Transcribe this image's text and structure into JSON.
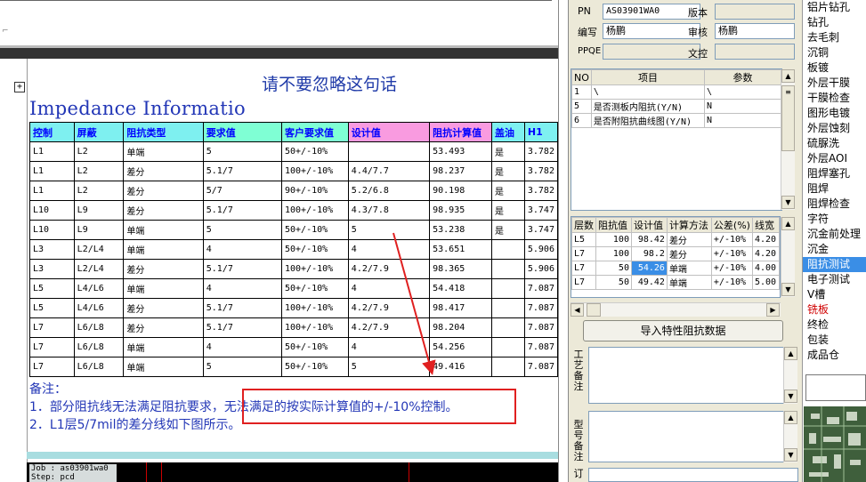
{
  "doc": {
    "banner": "请不要忽略这句话",
    "title": "Impedance Informatio",
    "plus_glyph": "+",
    "columns": [
      "控制",
      "屏蔽",
      "阻抗类型",
      "要求值",
      "客户要求值",
      "设计值",
      "阻抗计算值",
      "盖油",
      "H1"
    ],
    "rows": [
      [
        "L1",
        "L2",
        "单端",
        "5",
        "50+/-10%",
        "",
        "53.493",
        "是",
        "3.782"
      ],
      [
        "L1",
        "L2",
        "差分",
        "5.1/7",
        "100+/-10%",
        "4.4/7.7",
        "98.237",
        "是",
        "3.782"
      ],
      [
        "L1",
        "L2",
        "差分",
        "5/7",
        "90+/-10%",
        "5.2/6.8",
        "90.198",
        "是",
        "3.782"
      ],
      [
        "L10",
        "L9",
        "差分",
        "5.1/7",
        "100+/-10%",
        "4.3/7.8",
        "98.935",
        "是",
        "3.747"
      ],
      [
        "L10",
        "L9",
        "单端",
        "5",
        "50+/-10%",
        "5",
        "53.238",
        "是",
        "3.747"
      ],
      [
        "L3",
        "L2/L4",
        "单端",
        "4",
        "50+/-10%",
        "4",
        "53.651",
        "",
        "5.906"
      ],
      [
        "L3",
        "L2/L4",
        "差分",
        "5.1/7",
        "100+/-10%",
        "4.2/7.9",
        "98.365",
        "",
        "5.906"
      ],
      [
        "L5",
        "L4/L6",
        "单端",
        "4",
        "50+/-10%",
        "4",
        "54.418",
        "",
        "7.087"
      ],
      [
        "L5",
        "L4/L6",
        "差分",
        "5.1/7",
        "100+/-10%",
        "4.2/7.9",
        "98.417",
        "",
        "7.087"
      ],
      [
        "L7",
        "L6/L8",
        "差分",
        "5.1/7",
        "100+/-10%",
        "4.2/7.9",
        "98.204",
        "",
        "7.087"
      ],
      [
        "L7",
        "L6/L8",
        "单端",
        "4",
        "50+/-10%",
        "4",
        "54.256",
        "",
        "7.087"
      ],
      [
        "L7",
        "L6/L8",
        "单端",
        "5",
        "50+/-10%",
        "5",
        "49.416",
        "",
        "7.087"
      ]
    ],
    "notes": {
      "heading": "备注：",
      "line1": "1．部分阻抗线无法满足阻抗要求，无法满足的按实际计算值的+/-10%控制。",
      "line2": "2．L1层5/7mil的差分线如下图所示。"
    },
    "job_line1": "Job : as03901wa0",
    "job_line2": "Step: pcd"
  },
  "panel": {
    "pn_label": "PN",
    "pn_value": "AS03901WA0",
    "version_label": "版本",
    "version_value": "",
    "author_label": "编写",
    "author_value": "杨鹏",
    "review_label": "审核",
    "review_value": "杨鹏",
    "ppqe_label": "PPQE",
    "ppqe_value": "",
    "doc_label": "文控",
    "doc_value": "",
    "params_headers": [
      "NO",
      "项目",
      "参数"
    ],
    "params_rows": [
      [
        "1",
        "\\",
        "\\"
      ],
      [
        "5",
        "是否测板内阻抗(Y/N)",
        "N"
      ],
      [
        "6",
        "是否附阻抗曲线图(Y/N)",
        "N"
      ]
    ],
    "imp_headers": [
      "层数",
      "阻抗值",
      "设计值",
      "计算方法",
      "公差(%)",
      "线宽"
    ],
    "imp_rows": [
      [
        "L5",
        "100",
        "98.42",
        "差分",
        "+/-10%",
        "4.20"
      ],
      [
        "L7",
        "100",
        "98.2",
        "差分",
        "+/-10%",
        "4.20"
      ],
      [
        "L7",
        "50",
        "54.26",
        "单端",
        "+/-10%",
        "4.00"
      ],
      [
        "L7",
        "50",
        "49.42",
        "单端",
        "+/-10%",
        "5.00"
      ]
    ],
    "import_button": "导入特性阻抗数据",
    "process_memo_label": "工艺备注",
    "model_memo_label": "型号备注",
    "memo_last_label": "订"
  },
  "menu": {
    "items": [
      "铝片钻孔",
      "钻孔",
      "去毛刺",
      "沉铜",
      "板镀",
      "外层干膜",
      "干膜检查",
      "图形电镀",
      "外层蚀刻",
      "硫脲洗",
      "外层AOI",
      "阻焊塞孔",
      "阻焊",
      "阻焊检查",
      "字符",
      "沉金前处理",
      "沉金",
      "阻抗测试",
      "电子测试",
      "V槽",
      "铣板",
      "终检",
      "包装",
      "成品仓"
    ],
    "selected_index": 17,
    "red_index": 20
  },
  "colors": {
    "title_blue": "#2236b6",
    "header_cyan": "#7ef0f0",
    "header_pink": "#f99be0",
    "highlight_red": "#e02020",
    "selection_blue": "#3a8ee6"
  }
}
